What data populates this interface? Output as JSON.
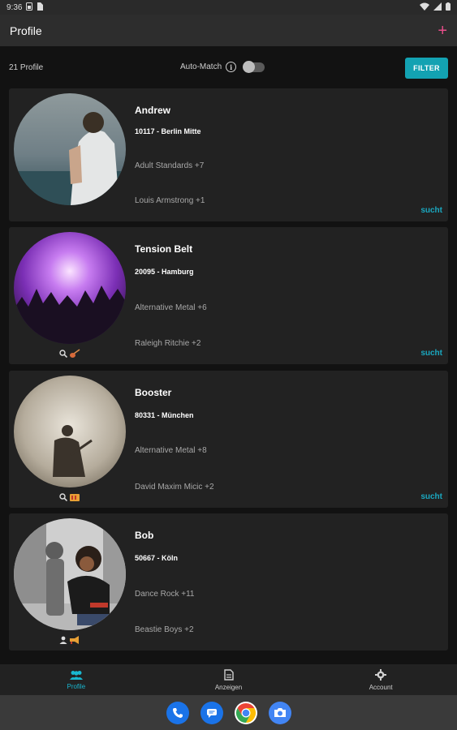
{
  "status_bar": {
    "time": "9:36"
  },
  "app_bar": {
    "title": "Profile",
    "add_label": "+"
  },
  "toolbar": {
    "count": "21 Profile",
    "automatch_label": "Auto-Match",
    "automatch_on": false,
    "filter_label": "FILTER"
  },
  "profiles": [
    {
      "name": "Andrew",
      "location": "10117 - Berlin Mitte",
      "genres": "Adult Standards +7",
      "artists": "Louis Armstrong +1",
      "status": "sucht"
    },
    {
      "name": "Tension Belt",
      "location": "20095 - Hamburg",
      "genres": "Alternative Metal +6",
      "artists": "Raleigh Ritchie +2",
      "status": "sucht"
    },
    {
      "name": "Booster",
      "location": "80331 - München",
      "genres": "Alternative Metal +8",
      "artists": "David Maxim Micic +2",
      "status": "sucht"
    },
    {
      "name": "Bob",
      "location": "50667 - Köln",
      "genres": "Dance Rock +11",
      "artists": "Beastie Boys +2",
      "status": ""
    }
  ],
  "bottom_nav": [
    {
      "label": "Profile",
      "icon": "people-icon",
      "active": true
    },
    {
      "label": "Anzeigen",
      "icon": "document-icon",
      "active": false
    },
    {
      "label": "Account",
      "icon": "gear-icon",
      "active": false
    }
  ],
  "dock": [
    "phone-icon",
    "messages-icon",
    "chrome-icon",
    "camera-icon"
  ],
  "colors": {
    "accent": "#13a2b2",
    "link": "#1aa8c0",
    "add": "#e84e8a",
    "card": "#222222",
    "background": "#121212"
  }
}
